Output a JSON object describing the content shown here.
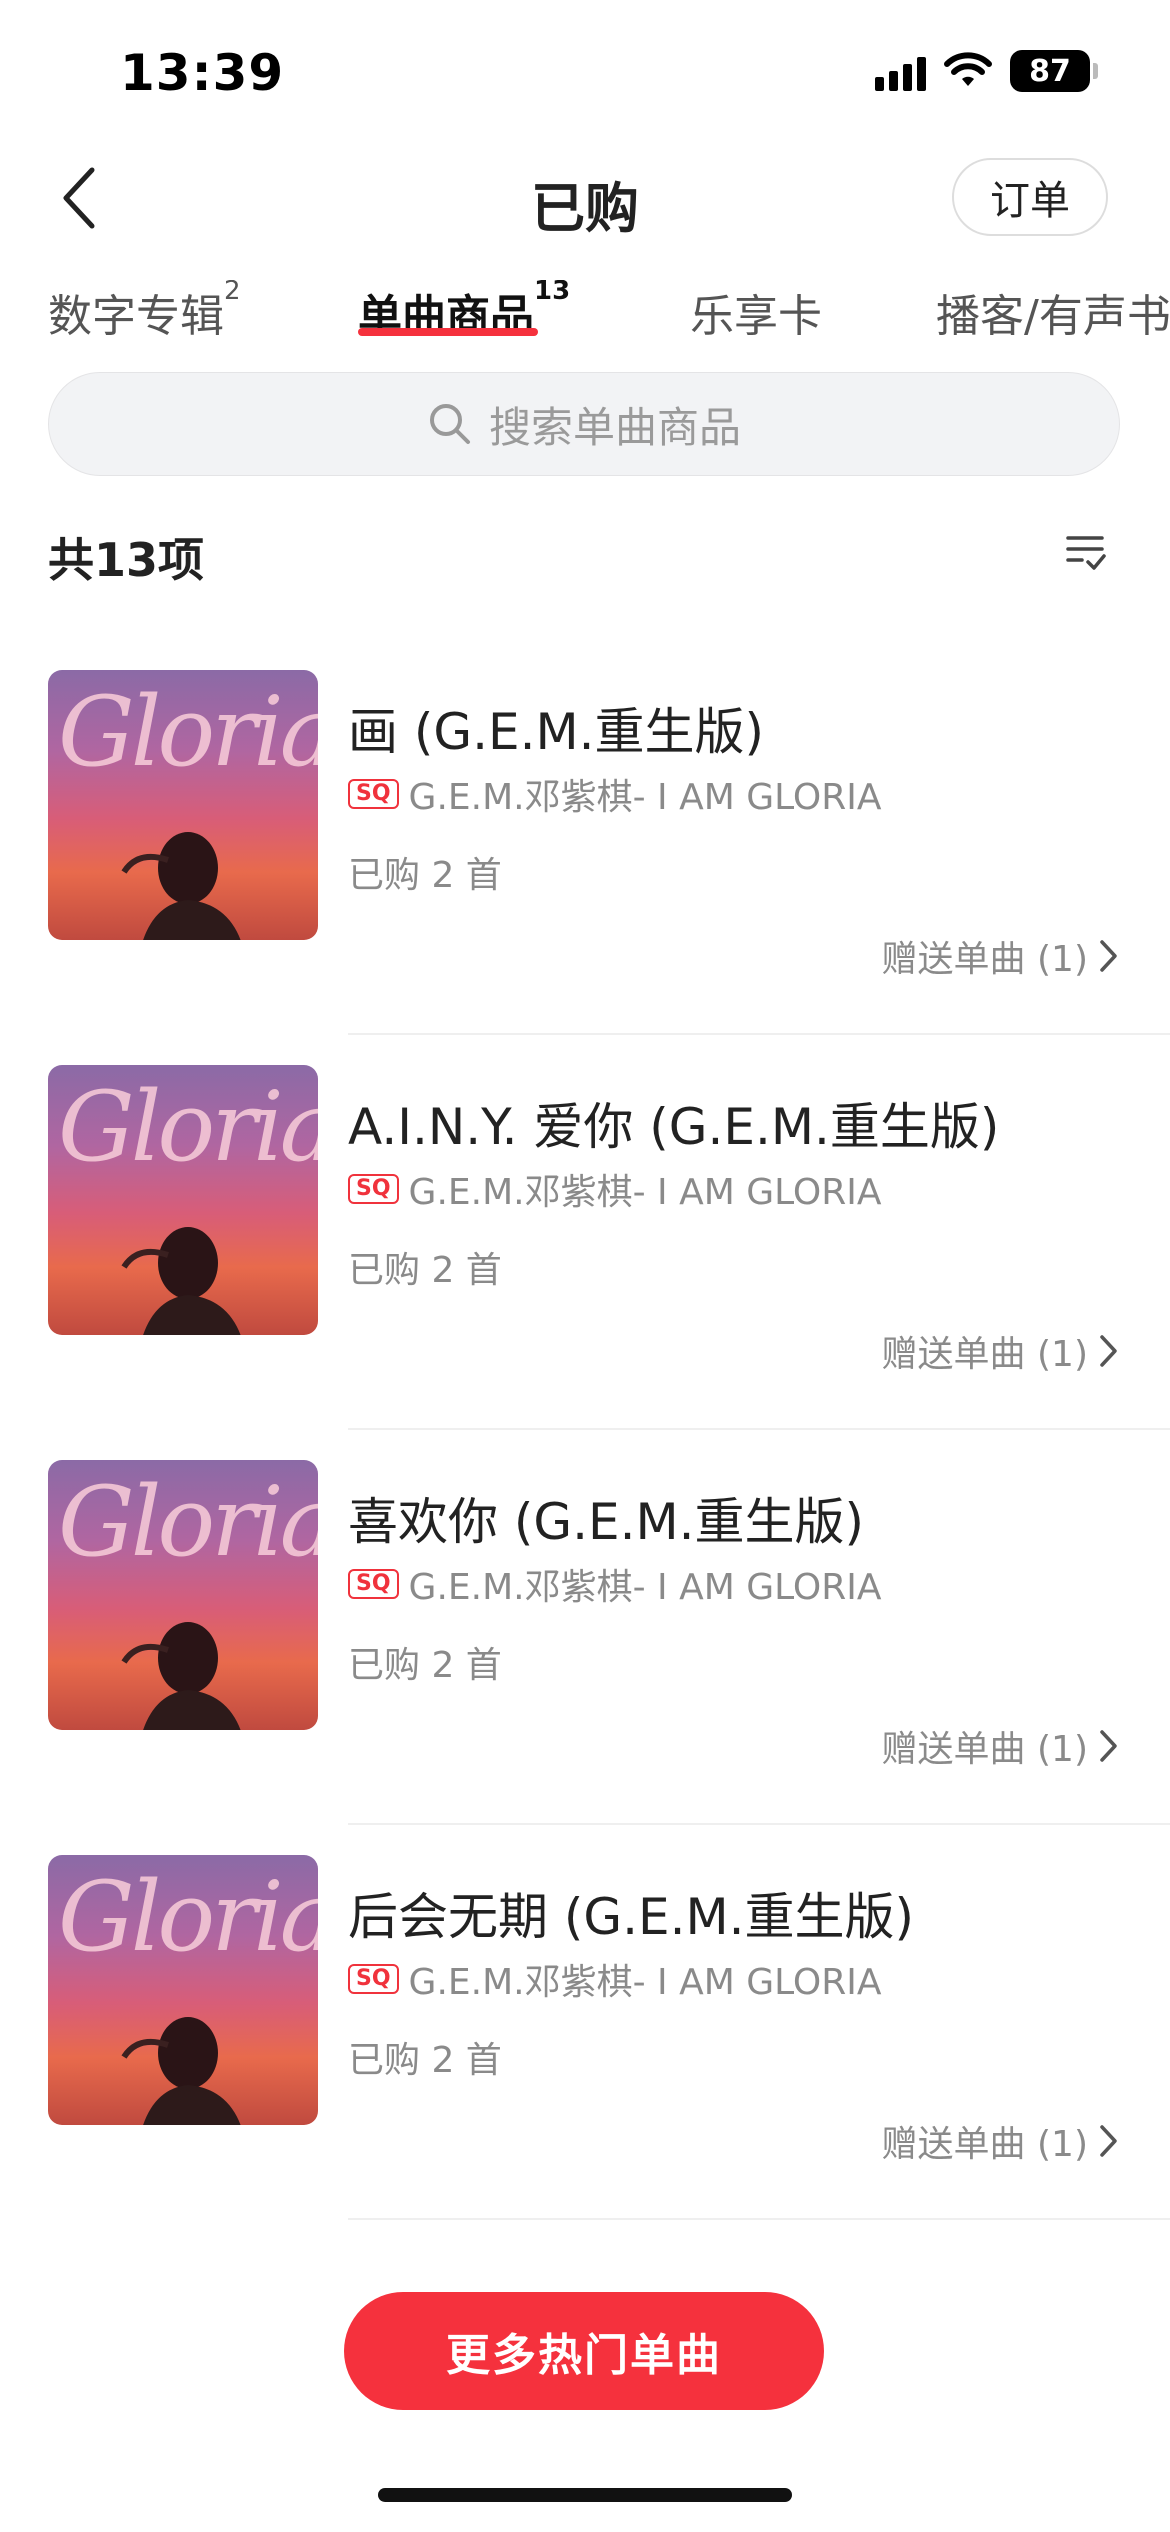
{
  "status_bar": {
    "time": "13:39",
    "battery": "87"
  },
  "header": {
    "title": "已购",
    "order_label": "订单"
  },
  "tabs": [
    {
      "label": "数字专辑",
      "count": "2"
    },
    {
      "label": "单曲商品",
      "count": "13",
      "active": true
    },
    {
      "label": "乐享卡",
      "count": ""
    },
    {
      "label": "播客/有声书",
      "count": ""
    }
  ],
  "search": {
    "placeholder": "搜索单曲商品"
  },
  "summary": {
    "count_text": "共13项"
  },
  "items": [
    {
      "title": "画 (G.E.M.重生版)",
      "quality": "SQ",
      "artist_album": "G.E.M.邓紫棋- I AM GLORIA",
      "bought": "已购 2 首",
      "gift": "赠送单曲 (1)",
      "cover_text": "Gloria"
    },
    {
      "title": "A.I.N.Y. 爱你 (G.E.M.重生版)",
      "quality": "SQ",
      "artist_album": "G.E.M.邓紫棋- I AM GLORIA",
      "bought": "已购 2 首",
      "gift": "赠送单曲 (1)",
      "cover_text": "Gloria"
    },
    {
      "title": "喜欢你 (G.E.M.重生版)",
      "quality": "SQ",
      "artist_album": "G.E.M.邓紫棋- I AM GLORIA",
      "bought": "已购 2 首",
      "gift": "赠送单曲 (1)",
      "cover_text": "Gloria"
    },
    {
      "title": "后会无期 (G.E.M.重生版)",
      "quality": "SQ",
      "artist_album": "G.E.M.邓紫棋- I AM GLORIA",
      "bought": "已购 2 首",
      "gift": "赠送单曲 (1)",
      "cover_text": "Gloria"
    }
  ],
  "cta": {
    "label": "更多热门单曲"
  },
  "colors": {
    "accent": "#f5313d"
  }
}
